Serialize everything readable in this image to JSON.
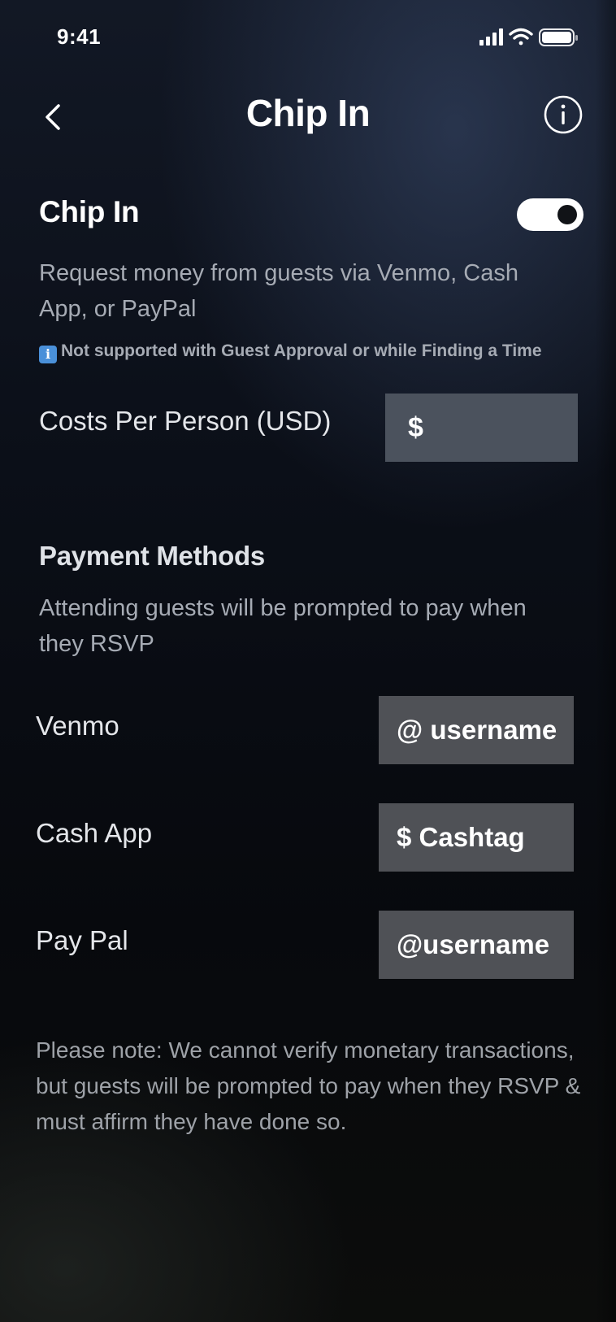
{
  "status_bar": {
    "time": "9:41"
  },
  "nav": {
    "title": "Chip In",
    "back_icon": "chevron-left-icon",
    "info_icon": "info-circle-icon"
  },
  "chip_in": {
    "title": "Chip In",
    "toggle_on": true,
    "description": "Request money from guests via Venmo, Cash App, or PayPal",
    "notice_icon": "info-square-icon",
    "notice": "Not supported with Guest Approval or while Finding a Time"
  },
  "cost": {
    "label": "Costs Per Person (USD)",
    "placeholder": "$"
  },
  "payment_methods": {
    "title": "Payment Methods",
    "description": "Attending guests will be prompted to pay when they RSVP",
    "methods": [
      {
        "label": "Venmo",
        "placeholder": "@ username"
      },
      {
        "label": "Cash App",
        "placeholder": "$ Cashtag"
      },
      {
        "label": "Pay Pal",
        "placeholder": "@username"
      }
    ]
  },
  "footnote": "Please note: We cannot verify monetary transactions, but guests will be prompted to pay when they RSVP & must affirm they have done so.",
  "colors": {
    "background": "#0b0f18",
    "input_cost": "#4b525d",
    "input_method": "#4f5156",
    "muted_text": "#a6abb4",
    "toggle_on": "#ffffff"
  }
}
